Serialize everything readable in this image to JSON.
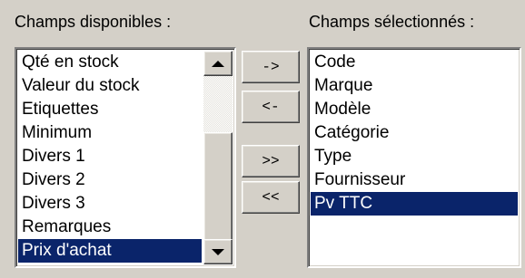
{
  "available": {
    "caption": "Champs disponibles :",
    "items": [
      {
        "label": "Qté en stock",
        "selected": false
      },
      {
        "label": "Valeur du stock",
        "selected": false
      },
      {
        "label": "Etiquettes",
        "selected": false
      },
      {
        "label": "Minimum",
        "selected": false
      },
      {
        "label": "Divers 1",
        "selected": false
      },
      {
        "label": "Divers 2",
        "selected": false
      },
      {
        "label": "Divers 3",
        "selected": false
      },
      {
        "label": "Remarques",
        "selected": false
      },
      {
        "label": "Prix d'achat",
        "selected": true
      }
    ]
  },
  "selected": {
    "caption": "Champs sélectionnés :",
    "items": [
      {
        "label": "Code",
        "selected": false
      },
      {
        "label": "Marque",
        "selected": false
      },
      {
        "label": "Modèle",
        "selected": false
      },
      {
        "label": "Catégorie",
        "selected": false
      },
      {
        "label": "Type",
        "selected": false
      },
      {
        "label": "Fournisseur",
        "selected": false
      },
      {
        "label": "Pv TTC",
        "selected": true
      }
    ]
  },
  "buttons": {
    "add": "->",
    "remove": "<-",
    "add_all": ">>",
    "remove_all": "<<"
  },
  "icons": {
    "scroll_up": "triangle-up",
    "scroll_down": "triangle-down"
  },
  "colors": {
    "selection_bg": "#0a246a",
    "selection_text": "#ffffff",
    "window_bg": "#d4d0c8"
  }
}
